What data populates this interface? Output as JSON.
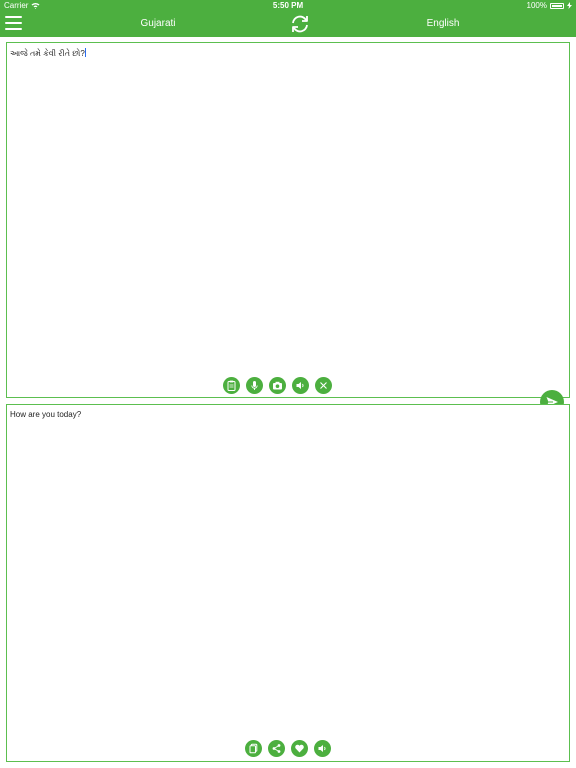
{
  "status_bar": {
    "carrier": "Carrier",
    "time": "5:50 PM",
    "battery": "100%"
  },
  "nav": {
    "source_language": "Gujarati",
    "target_language": "English"
  },
  "source": {
    "text": "આજે તમે કેવી રીતે છો?"
  },
  "target": {
    "text": "How are you today?"
  },
  "icons": {
    "menu": "menu-icon",
    "swap": "swap-languages-icon",
    "send": "send-icon",
    "source_tools": [
      "clipboard-icon",
      "microphone-icon",
      "camera-icon",
      "speaker-icon",
      "close-icon"
    ],
    "target_tools": [
      "copy-icon",
      "share-icon",
      "heart-icon",
      "speaker-icon"
    ]
  },
  "colors": {
    "accent": "#4caf3f",
    "border": "#5cbf4f",
    "caret": "#2a6cf0"
  }
}
